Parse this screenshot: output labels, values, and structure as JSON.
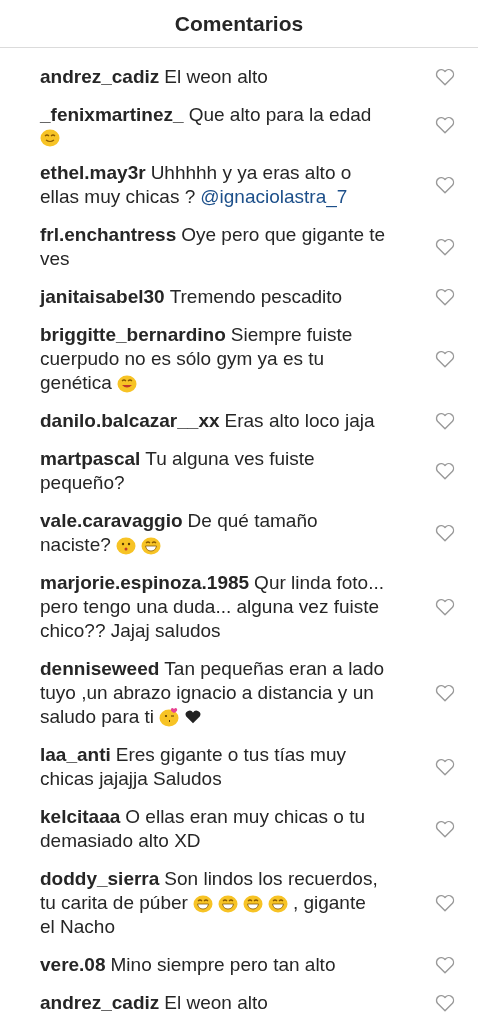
{
  "header": {
    "title": "Comentarios"
  },
  "comments": [
    {
      "user": "andrez_cadiz",
      "lines": [
        [
          {
            "kind": "text",
            "text": "El weon alto"
          }
        ]
      ],
      "liked": false
    },
    {
      "user": "_fenixmartinez_",
      "lines": [
        [
          {
            "kind": "text",
            "text": "Que alto para la edad"
          }
        ],
        [
          {
            "kind": "smile"
          }
        ]
      ],
      "liked": false
    },
    {
      "user": "ethel.may3r",
      "lines": [
        [
          {
            "kind": "text",
            "text": "Uhhhhh y ya eras alto o"
          }
        ],
        [
          {
            "kind": "text",
            "text": "ellas muy chicas ?"
          },
          {
            "kind": "mention",
            "text": "@ignaciolastra_7"
          }
        ]
      ],
      "liked": false
    },
    {
      "user": "frl.enchantress",
      "lines": [
        [
          {
            "kind": "text",
            "text": "Oye pero que gigante te"
          }
        ],
        [
          {
            "kind": "text",
            "text": "ves"
          }
        ]
      ],
      "liked": false
    },
    {
      "user": "janitaisabel30",
      "lines": [
        [
          {
            "kind": "text",
            "text": "Tremendo pescadito"
          }
        ]
      ],
      "liked": false
    },
    {
      "user": "briggitte_bernardino",
      "lines": [
        [
          {
            "kind": "text",
            "text": "Siempre fuiste"
          }
        ],
        [
          {
            "kind": "text",
            "text": "cuerpudo no es sólo gym ya es tu"
          }
        ],
        [
          {
            "kind": "text",
            "text": "genética"
          },
          {
            "kind": "yum"
          }
        ]
      ],
      "liked": false
    },
    {
      "user": "danilo.balcazar__xx",
      "lines": [
        [
          {
            "kind": "text",
            "text": "Eras alto loco jaja"
          }
        ]
      ],
      "liked": false
    },
    {
      "user": "martpascal",
      "lines": [
        [
          {
            "kind": "text",
            "text": "Tu alguna ves fuiste"
          }
        ],
        [
          {
            "kind": "text",
            "text": "pequeño?"
          }
        ]
      ],
      "liked": false
    },
    {
      "user": "vale.caravaggio",
      "lines": [
        [
          {
            "kind": "text",
            "text": "De qué tamaño"
          }
        ],
        [
          {
            "kind": "text",
            "text": "naciste?"
          },
          {
            "kind": "hush"
          },
          {
            "kind": "grin"
          }
        ]
      ],
      "liked": false
    },
    {
      "user": "marjorie.espinoza.1985",
      "lines": [
        [
          {
            "kind": "text",
            "text": "Qur linda foto..."
          }
        ],
        [
          {
            "kind": "text",
            "text": "pero tengo una duda... alguna vez fuiste"
          }
        ],
        [
          {
            "kind": "text",
            "text": "chico?? Jajaj saludos"
          }
        ]
      ],
      "liked": false
    },
    {
      "user": "denniseweed",
      "lines": [
        [
          {
            "kind": "text",
            "text": "Tan pequeñas eran a lado"
          }
        ],
        [
          {
            "kind": "text",
            "text": "tuyo ,un abrazo ignacio a distancia y un"
          }
        ],
        [
          {
            "kind": "text",
            "text": "saludo para ti"
          },
          {
            "kind": "kiss"
          },
          {
            "kind": "heart"
          }
        ]
      ],
      "liked": false
    },
    {
      "user": "laa_anti",
      "lines": [
        [
          {
            "kind": "text",
            "text": "Eres gigante o tus tías muy"
          }
        ],
        [
          {
            "kind": "text",
            "text": "chicas jajajja Saludos"
          }
        ]
      ],
      "liked": false
    },
    {
      "user": "kelcitaaa",
      "lines": [
        [
          {
            "kind": "text",
            "text": "O ellas eran muy chicas o tu"
          }
        ],
        [
          {
            "kind": "text",
            "text": "demasiado alto XD"
          }
        ]
      ],
      "liked": false
    },
    {
      "user": "doddy_sierra",
      "lines": [
        [
          {
            "kind": "text",
            "text": "Son lindos los recuerdos,"
          }
        ],
        [
          {
            "kind": "text",
            "text": "tu carita de púber"
          },
          {
            "kind": "grin"
          },
          {
            "kind": "grin"
          },
          {
            "kind": "grin"
          },
          {
            "kind": "grin"
          },
          {
            "kind": "text",
            "text": ", gigante"
          }
        ],
        [
          {
            "kind": "text",
            "text": "el Nacho"
          }
        ]
      ],
      "liked": false
    },
    {
      "user": "vere.08",
      "lines": [
        [
          {
            "kind": "text",
            "text": "Mino siempre pero tan alto"
          }
        ]
      ],
      "liked": false
    },
    {
      "user": "andrez_cadiz",
      "lines": [
        [
          {
            "kind": "text",
            "text": "El weon alto"
          }
        ]
      ],
      "liked": false
    }
  ]
}
